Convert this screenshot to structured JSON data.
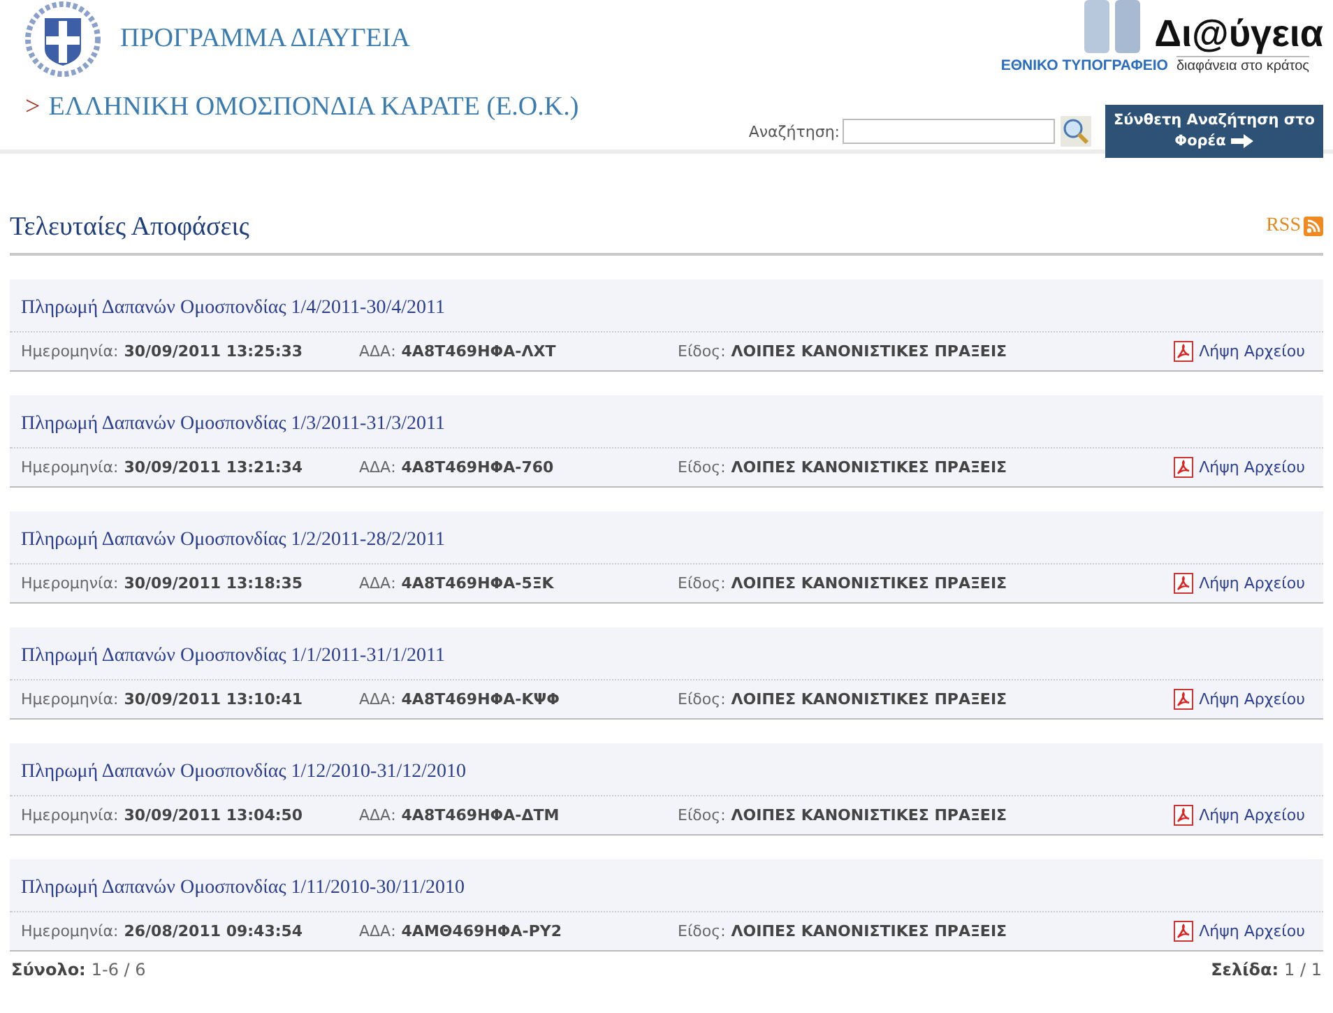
{
  "header": {
    "title": "ΠΡΟΓΡΑΜΜΑ ΔΙΑΥΓΕΙΑ",
    "breadcrumb_marker": ">",
    "organization": "ΕΛΛΗΝΙΚΗ ΟΜΟΣΠΟΝΔΙΑ ΚΑΡΑΤΕ (Ε.Ο.Κ.)",
    "logo": {
      "name": "Δι@ύγεια",
      "publisher": "ΕΘΝΙΚΟ ΤΥΠΟΓΡΑΦΕΙΟ",
      "slogan": "διαφάνεια στο κράτος"
    },
    "search": {
      "label": "Αναζήτηση:"
    },
    "advanced_search_button": "Σύνθετη Αναζήτηση στο Φορέα"
  },
  "section": {
    "title": "Τελευταίες Αποφάσεις",
    "rss": "RSS"
  },
  "decisions": [
    {
      "title": "Πληρωμή Δαπανών Ομοσπονδίας 1/4/2011-30/4/2011",
      "date_label": "Ημερομηνία:",
      "date": "30/09/2011 13:25:33",
      "ada_label": "ΑΔΑ:",
      "ada": "4Α8Τ469ΗΦΑ-ΛΧΤ",
      "type_label": "Είδος:",
      "type": "ΛΟΙΠΕΣ ΚΑΝΟΝΙΣΤΙΚΕΣ ΠΡΑΞΕΙΣ",
      "download": "Λήψη Αρχείου"
    },
    {
      "title": "Πληρωμή Δαπανών Ομοσπονδίας 1/3/2011-31/3/2011",
      "date_label": "Ημερομηνία:",
      "date": "30/09/2011 13:21:34",
      "ada_label": "ΑΔΑ:",
      "ada": "4Α8Τ469ΗΦΑ-760",
      "type_label": "Είδος:",
      "type": "ΛΟΙΠΕΣ ΚΑΝΟΝΙΣΤΙΚΕΣ ΠΡΑΞΕΙΣ",
      "download": "Λήψη Αρχείου"
    },
    {
      "title": "Πληρωμή Δαπανών Ομοσπονδίας 1/2/2011-28/2/2011",
      "date_label": "Ημερομηνία:",
      "date": "30/09/2011 13:18:35",
      "ada_label": "ΑΔΑ:",
      "ada": "4Α8Τ469ΗΦΑ-5ΞΚ",
      "type_label": "Είδος:",
      "type": "ΛΟΙΠΕΣ ΚΑΝΟΝΙΣΤΙΚΕΣ ΠΡΑΞΕΙΣ",
      "download": "Λήψη Αρχείου"
    },
    {
      "title": "Πληρωμή Δαπανών Ομοσπονδίας 1/1/2011-31/1/2011",
      "date_label": "Ημερομηνία:",
      "date": "30/09/2011 13:10:41",
      "ada_label": "ΑΔΑ:",
      "ada": "4Α8Τ469ΗΦΑ-ΚΨΦ",
      "type_label": "Είδος:",
      "type": "ΛΟΙΠΕΣ ΚΑΝΟΝΙΣΤΙΚΕΣ ΠΡΑΞΕΙΣ",
      "download": "Λήψη Αρχείου"
    },
    {
      "title": "Πληρωμή Δαπανών Ομοσπονδίας 1/12/2010-31/12/2010",
      "date_label": "Ημερομηνία:",
      "date": "30/09/2011 13:04:50",
      "ada_label": "ΑΔΑ:",
      "ada": "4Α8Τ469ΗΦΑ-ΔΤΜ",
      "type_label": "Είδος:",
      "type": "ΛΟΙΠΕΣ ΚΑΝΟΝΙΣΤΙΚΕΣ ΠΡΑΞΕΙΣ",
      "download": "Λήψη Αρχείου"
    },
    {
      "title": "Πληρωμή Δαπανών Ομοσπονδίας 1/11/2010-30/11/2010",
      "date_label": "Ημερομηνία:",
      "date": "26/08/2011 09:43:54",
      "ada_label": "ΑΔΑ:",
      "ada": "4ΑΜΘ469ΗΦΑ-ΡΥ2",
      "type_label": "Είδος:",
      "type": "ΛΟΙΠΕΣ ΚΑΝΟΝΙΣΤΙΚΕΣ ΠΡΑΞΕΙΣ",
      "download": "Λήψη Αρχείου"
    }
  ],
  "footer": {
    "total_label": "Σύνολο:",
    "total": "1-6 / 6",
    "page_label": "Σελίδα:",
    "page": "1 / 1"
  }
}
